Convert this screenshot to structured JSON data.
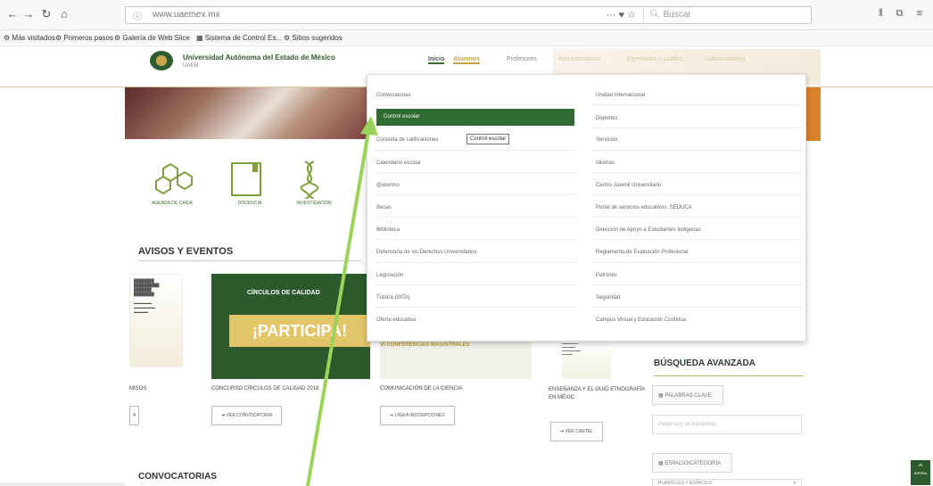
{
  "browser": {
    "nav_buttons": [
      "←",
      "→",
      "↻",
      "⌂"
    ],
    "url": "www.uaemex.mx",
    "url_icons": "··· ♥ ☆",
    "search_placeholder": "Buscar",
    "right_icons": "⫴ ⧉ ≡"
  },
  "bookmarks": [
    {
      "label": "Más visitados"
    },
    {
      "label": "Primeros pasos"
    },
    {
      "label": "Galería de Web Slice"
    },
    {
      "label": "Sistema de Control Es..."
    },
    {
      "label": "Sitios sugeridos"
    }
  ],
  "header": {
    "logo_text": "Universidad Autónoma del Estado de México",
    "logo_sub": "UAEM",
    "nav": [
      {
        "label": "Inicio"
      },
      {
        "label": "Alumnos"
      },
      {
        "label": "Profesores"
      },
      {
        "label": "Administrativos"
      },
      {
        "label": "Egresados y público"
      },
      {
        "label": "Colaboradores"
      }
    ]
  },
  "icons": [
    {
      "label": "AGENDA DE CAIDA",
      "icon": "hexagon-molecule-icon"
    },
    {
      "label": "DOCENCIA",
      "icon": "document-icon"
    },
    {
      "label": "INVESTIGACIÓN",
      "icon": "dna-icon"
    }
  ],
  "avisos": {
    "title": "AVISOS Y EVENTOS",
    "cards": [
      {
        "title": "MISOS",
        "button": "A"
      },
      {
        "title": "CONCURSO CÍRCULOS DE CALIDAD 2018",
        "button": "VER CONVOCATORIA",
        "banner_text": "CÍRCULOS DE CALIDAD",
        "banner_big": "¡PARTICIPA!"
      },
      {
        "title": "COMUNICACIÓN DE LA CIENCIA",
        "button": "LIGA A INSCRIPCIONES",
        "banner_text": "VI CONFERENCIAS MAGISTRALES"
      },
      {
        "title": "ENSEÑANZA Y EL GUIÓ ETNOGRAFÍA EN MÉXIC",
        "button": "VER CARTEL"
      }
    ]
  },
  "convocatorias_title": "CONVOCATORIAS",
  "busqueda": {
    "title": "BÚSQUEDA AVANZADA",
    "button1": "PALABRAS CLAVE",
    "input_placeholder": "Palabra(s) de búsqueda",
    "button2": "ESPACIO/CATEGORÍA",
    "select_value": "PLANTELES Y ESPACIOS"
  },
  "scroll_top": {
    "arrow": "^",
    "label": "ARRIBA"
  },
  "dropdown": {
    "left": [
      "Convocatorias",
      "Control escolar",
      "Consulta de calificaciones",
      "Calendario escolar",
      "@alumno",
      "Becas",
      "Biblioteca",
      "Defensoría de los Derechos Universitarios",
      "Legislación",
      "Tutoría (SITA)",
      "Oferta educativa"
    ],
    "right": [
      "Unidad Internacional",
      "Deportes",
      "Servicios",
      "Idiomas",
      "Centro Juvenil Universitario",
      "Portal de servicios educativos, SEDUCA",
      "Dirección de Apoyo a Estudiantes Indígenas",
      "Reglamento de Evaluación Profesional",
      "Patronos",
      "Seguridad",
      "Campus Virtual y Educación Continua"
    ],
    "active_index": 1,
    "tooltip": "Control escolar"
  }
}
